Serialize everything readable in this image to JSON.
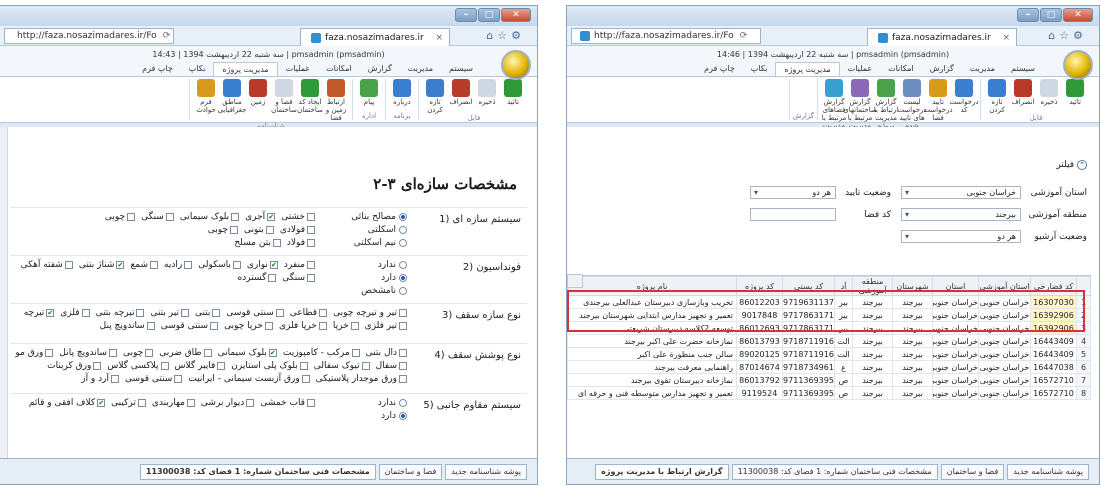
{
  "left": {
    "url": "http://faza.nosazimadares.ir/Fo",
    "tab_title": "faza.nosazimadares.ir",
    "info_line": "سه شنبه 22 اردیبهشت 1394 | 14:43 | pmsadmin (pmsadmin)",
    "ribbon_tabs": [
      "سیستم",
      "مدیریت",
      "گزارش",
      "امکانات",
      "عملیات",
      "مدیریت پروژه",
      "بکاپ",
      "چاپ فرم"
    ],
    "ribbon_groups": [
      {
        "label": "فایل",
        "buttons": [
          "تائید",
          "ذخیره",
          "انصراف",
          "تازه کردن"
        ]
      },
      {
        "label": "برنامه",
        "buttons": [
          "درباره"
        ]
      },
      {
        "label": "اداره",
        "buttons": [
          "پیام"
        ]
      },
      {
        "label": "شناسنامه",
        "buttons": [
          "ارتباط زمین و فضا",
          "ایجاد کد ساختمان",
          "فضا و ساختمان",
          "زمین",
          "مناطق جغرافیایی",
          "فرم حوادث"
        ]
      }
    ],
    "section_title": "۲-۳ مشخصات سازه‌ای",
    "questions": [
      {
        "label": "1) سیستم سازه ای",
        "radios": [
          {
            "text": "مصالح بنائی",
            "on": true
          },
          {
            "text": "اسکلتی",
            "on": false
          },
          {
            "text": "نیم اسکلتی",
            "on": false
          }
        ],
        "check_lines": [
          [
            {
              "t": "خشتی",
              "c": false
            },
            {
              "t": "آجری",
              "c": true
            },
            {
              "t": "بلوک سیمانی",
              "c": false
            },
            {
              "t": "سنگی",
              "c": false
            },
            {
              "t": "چوبی",
              "c": false
            }
          ],
          [
            {
              "t": "فولادی",
              "c": false
            },
            {
              "t": "بتونی",
              "c": false
            },
            {
              "t": "چوبی",
              "c": false
            }
          ],
          [
            {
              "t": "فولاد",
              "c": false
            },
            {
              "t": "بتن مسلح",
              "c": false
            }
          ]
        ]
      },
      {
        "label": "2) فونداسیون",
        "radios": [
          {
            "text": "ندارد",
            "on": false
          },
          {
            "text": "دارد",
            "on": true
          },
          {
            "text": "نامشخص",
            "on": false
          }
        ],
        "check_lines": [
          [
            {
              "t": "منفرد",
              "c": false
            },
            {
              "t": "نواری",
              "c": true
            },
            {
              "t": "باسکولی",
              "c": false
            },
            {
              "t": "رادیه",
              "c": false
            },
            {
              "t": "شمع",
              "c": false
            },
            {
              "t": "شناژ بتنی",
              "c": true
            },
            {
              "t": "شفته آهکی",
              "c": false
            }
          ],
          [
            {
              "t": "سنگی",
              "c": false
            },
            {
              "t": "گسترده",
              "c": false
            }
          ]
        ]
      },
      {
        "label": "3) نوع سازه سقف",
        "radios": [],
        "check_lines": [
          [
            {
              "t": "تیر و تیرچه چوبی",
              "c": false
            },
            {
              "t": "قطاعی",
              "c": false
            },
            {
              "t": "سنتی قوسی",
              "c": false
            },
            {
              "t": "بتنی",
              "c": false
            },
            {
              "t": "تیر بتنی",
              "c": false
            },
            {
              "t": "تیرچه بتنی",
              "c": false
            },
            {
              "t": "فلزی",
              "c": false
            },
            {
              "t": "تیرچه",
              "c": true
            }
          ],
          [
            {
              "t": "تیر فلزی",
              "c": false
            },
            {
              "t": "خرپا",
              "c": false
            },
            {
              "t": "خرپا فلزی",
              "c": false
            },
            {
              "t": "خرپا چوبی",
              "c": false
            },
            {
              "t": "سنتی قوسی",
              "c": false
            },
            {
              "t": "ساندویچ پنل",
              "c": false
            }
          ]
        ]
      },
      {
        "label": "4) نوع پوشش سقف",
        "radios": [],
        "check_lines": [
          [
            {
              "t": "دال بتنی",
              "c": false
            },
            {
              "t": "مرکب - کامپوزیت",
              "c": false
            },
            {
              "t": "بلوک سیمانی",
              "c": true
            },
            {
              "t": "طاق ضربی",
              "c": false
            },
            {
              "t": "چوبی",
              "c": false
            },
            {
              "t": "ساندویچ پانل",
              "c": false
            },
            {
              "t": "ورق مو",
              "c": false
            }
          ],
          [
            {
              "t": "سفال",
              "c": false
            },
            {
              "t": "تیوک سفالی",
              "c": false
            },
            {
              "t": "بلوک پلی استایرن",
              "c": false
            },
            {
              "t": "فایبر گلاس",
              "c": false
            },
            {
              "t": "پلاکسی گلاس",
              "c": false
            },
            {
              "t": "ورق کربنات",
              "c": false
            }
          ],
          [
            {
              "t": "ورق موجدار پلاستیکی",
              "c": false
            },
            {
              "t": "ورق آزبست سیمانی - ایرانیت",
              "c": false
            },
            {
              "t": "سنتی قوسی",
              "c": false
            },
            {
              "t": "آرد و آز",
              "c": false
            }
          ]
        ]
      },
      {
        "label": "5) سیستم مقاوم جانبی",
        "radios": [
          {
            "text": "ندارد",
            "on": false
          },
          {
            "text": "دارد",
            "on": true
          }
        ],
        "check_lines": [
          [
            {
              "t": "قاب خمشی",
              "c": false
            },
            {
              "t": "دیوار برشی",
              "c": false
            },
            {
              "t": "مهاربندی",
              "c": false
            },
            {
              "t": "ترکیبی",
              "c": false
            },
            {
              "t": "کلاف افقی و قائم",
              "c": true
            }
          ]
        ]
      }
    ],
    "status_tabs": [
      "پوشه شناسنامه جدید",
      "فضا و ساختمان",
      "مشخصات فنی ساختمان شماره: 1 فضای کد: 11300038"
    ]
  },
  "right": {
    "url": "http://faza.nosazimadares.ir/Fo",
    "tab_title": "faza.nosazimadares.ir",
    "info_line": "سه شنبه 22 اردیبهشت 1394 | 14:46 | pmsadmin (pmsadmin)",
    "ribbon_tabs": [
      "سیستم",
      "مدیریت",
      "گزارش",
      "امکانات",
      "عملیات",
      "مدیریت پروژه",
      "بکاپ",
      "چاپ فرم"
    ],
    "ribbon_groups": [
      {
        "label": "فایل",
        "buttons": [
          "تائید",
          "ذخیره",
          "انصراف",
          "تازه کردن"
        ]
      },
      {
        "label": "مدیریت پروژه",
        "buttons": [
          "درخواست کد",
          "تایید درخواست فضا",
          "لیست درخواست های تایید شده",
          "گزارش ارتباط با مدیریت پروژه",
          "گزارش ساختمانهای مرتبط با مدیریت پروژه",
          "گزارش فضاهای مرتبط با مدیریت پروژه"
        ]
      },
      {
        "label": "گزارش",
        "buttons": []
      }
    ],
    "filter": {
      "title": "فیلتر",
      "province_label": "استان آموزشی",
      "province_value": "خراسان جنوبی",
      "approval_label": "وضعیت تایید",
      "approval_value": "هر دو",
      "region_label": "منطقه آموزشی",
      "region_value": "بیرجند",
      "space_code_label": "کد فضا",
      "space_code_value": "",
      "archive_label": "وضعیت آرشیو",
      "archive_value": "هر دو"
    },
    "table": {
      "headers": [
        "",
        "کد فضا‌رخی",
        "استان آموزشی",
        "استان",
        "شهرستان",
        "منطقه آموزشی",
        "آد",
        "کد پستی",
        "کد پروژه",
        "نام پروژه"
      ],
      "rows": [
        [
          "1",
          "16307030",
          "خراسان جنوبی",
          "خراسان جنوبی",
          "بیرجند",
          "بیرجند",
          "بیر",
          "9719631137",
          "86012203",
          "تخریب وبازسازی دبیرستان عبدالعلی بیرجندی"
        ],
        [
          "2",
          "16392906",
          "خراسان جنوبی",
          "خراسان جنوبی",
          "بیرجند",
          "بیرجند",
          "بیر",
          "9717863171",
          "9017848",
          "تعمیر و تجهیز مدارس ابتدایی شهرستان بیرجند"
        ],
        [
          "3",
          "16392906",
          "خراسان جنوبی",
          "خراسان جنوبی",
          "بیرجند",
          "بیرجند",
          "بیر",
          "9717863171",
          "86012693",
          "توسعه 2کلاسه دبیرستان شریعتی"
        ],
        [
          "4",
          "16443409",
          "خراسان جنوبی",
          "خراسان جنوبی",
          "بیرجند",
          "بیرجند",
          "الت",
          "9718711916",
          "86013793",
          "نمازخانه حضرت علی اکبر بیرجند"
        ],
        [
          "5",
          "16443409",
          "خراسان جنوبی",
          "خراسان جنوبی",
          "بیرجند",
          "بیرجند",
          "الت",
          "9718711916",
          "89020125",
          "سالن جنب منظورة علی اکبر"
        ],
        [
          "6",
          "16447038",
          "خراسان جنوبی",
          "خراسان جنوبی",
          "بیرجند",
          "بیرجند",
          "ع",
          "9718734961",
          "87014674",
          "راهنمایی معرفت بیرجند"
        ],
        [
          "7",
          "16572710",
          "خراسان جنوبی",
          "خراسان جنوبی",
          "بیرجند",
          "بیرجند",
          "ص",
          "9711369395",
          "86013792",
          "نمازخانه دبیرستان تقوی بیرجند"
        ],
        [
          "8",
          "16572710",
          "خراسان جنوبی",
          "خراسان جنوبی",
          "بیرجند",
          "بیرجند",
          "ص",
          "9711369395",
          "9119524",
          "تعمیر و تجهیز مدارس متوسطه فنی و حرفه ای"
        ]
      ]
    },
    "status_tabs": [
      "پوشه شناسنامه جدید",
      "فضا و ساختمان",
      "مشخصات فنی ساختمان شماره: 1 فضای کد: 11300038",
      "گزارش ارتباط با مدیریت پروژه"
    ]
  }
}
